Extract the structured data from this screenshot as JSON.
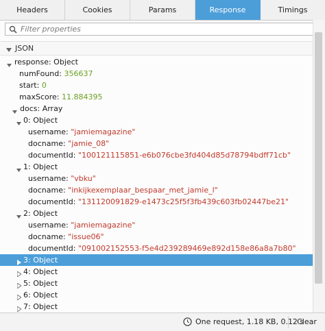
{
  "tabs": [
    {
      "label": "Headers"
    },
    {
      "label": "Cookies"
    },
    {
      "label": "Params"
    },
    {
      "label": "Response",
      "active": true
    },
    {
      "label": "Timings"
    }
  ],
  "filter": {
    "placeholder": "Filter properties"
  },
  "section": {
    "label": "JSON"
  },
  "tree": {
    "response": {
      "key": "response",
      "type": "Object"
    },
    "numFound": {
      "key": "numFound",
      "value": "356637"
    },
    "start": {
      "key": "start",
      "value": "0"
    },
    "maxScore": {
      "key": "maxScore",
      "value": "11.884395"
    },
    "docs": {
      "key": "docs",
      "type": "Array"
    },
    "items": [
      {
        "index": "0",
        "type": "Object",
        "expanded": true,
        "username": "\"jamiemagazine\"",
        "docname": "\"jamie_08\"",
        "documentId": "\"100121115851-e6b076cbe3fd404d85d78794bdff71cb\""
      },
      {
        "index": "1",
        "type": "Object",
        "expanded": true,
        "username": "\"vbku\"",
        "docname": "\"inkijkexemplaar_bespaar_met_jamie_l\"",
        "documentId": "\"131120091829-e1473c25f5f3fb439c603fb02447be21\""
      },
      {
        "index": "2",
        "type": "Object",
        "expanded": true,
        "username": "\"jamiemagazine\"",
        "docname": "\"issue06\"",
        "documentId": "\"091002152553-f5e4d239289469e892d158e86a8a7b80\""
      },
      {
        "index": "3",
        "type": "Object",
        "expanded": false,
        "selected": true
      },
      {
        "index": "4",
        "type": "Object",
        "expanded": false
      },
      {
        "index": "5",
        "type": "Object",
        "expanded": false
      },
      {
        "index": "6",
        "type": "Object",
        "expanded": false
      },
      {
        "index": "7",
        "type": "Object",
        "expanded": false
      }
    ],
    "field_labels": {
      "username": "username",
      "docname": "docname",
      "documentId": "documentId"
    }
  },
  "status": {
    "text": "One request, 1.18 KB, 0.12 s",
    "clear_label": "Clear"
  },
  "colors": {
    "accent": "#4c9ed9",
    "number": "#6aa121",
    "string": "#c0392b"
  }
}
